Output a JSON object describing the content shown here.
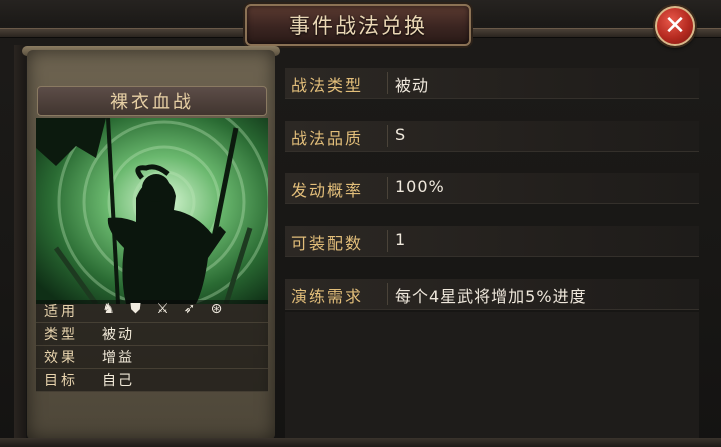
{
  "window": {
    "title": "事件战法兑换",
    "close_icon": "close-icon"
  },
  "skill_card": {
    "name": "裸衣血战",
    "attributes": [
      {
        "label": "适用",
        "value": "",
        "icons": [
          "cavalry-icon",
          "shield-icon",
          "crossed-swords-icon",
          "spear-icon",
          "crossbow-icon"
        ]
      },
      {
        "label": "类型",
        "value": "被动"
      },
      {
        "label": "效果",
        "value": "增益"
      },
      {
        "label": "目标",
        "value": "自己"
      }
    ]
  },
  "details": [
    {
      "label": "战法类型",
      "value": "被动"
    },
    {
      "label": "战法品质",
      "value": "S"
    },
    {
      "label": "发动概率",
      "value": "100%"
    },
    {
      "label": "可装配数",
      "value": "1"
    },
    {
      "label": "演练需求",
      "value": "每个4星武将增加5%进度"
    }
  ],
  "colors": {
    "label_gold": "#e2be7a",
    "close_red": "#b52a20",
    "art_green": "#72c076"
  }
}
